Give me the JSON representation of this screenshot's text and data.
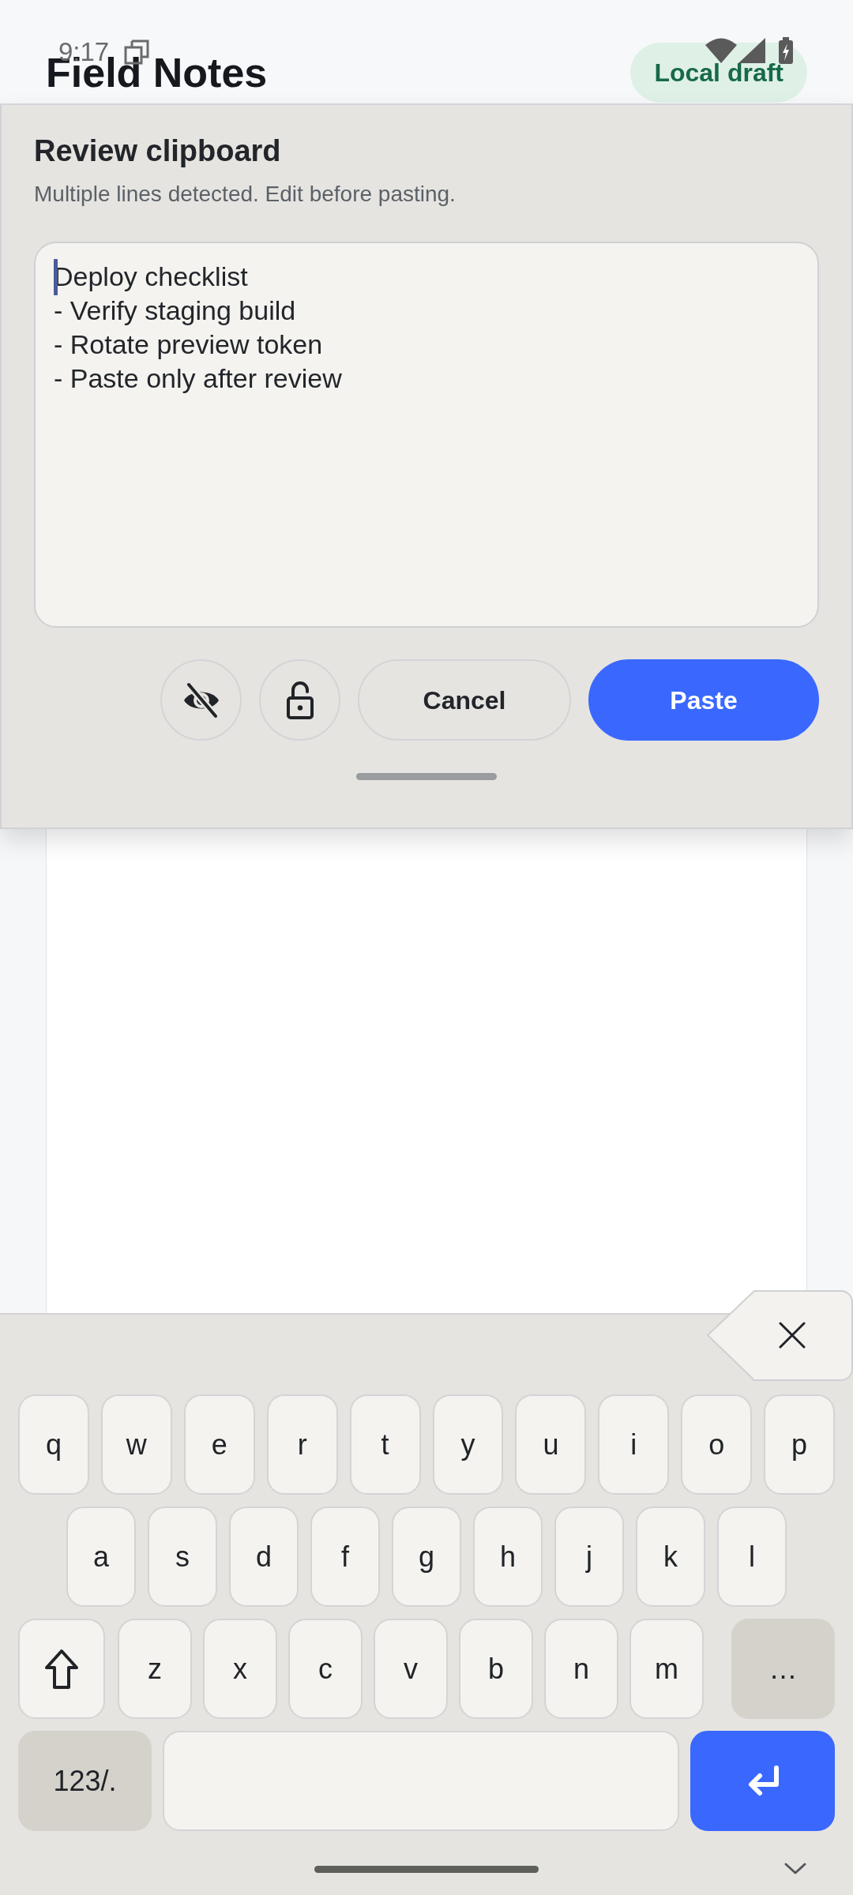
{
  "status_bar": {
    "time": "9:17"
  },
  "header": {
    "title": "Field Notes",
    "badge": "Local draft"
  },
  "dialog": {
    "title": "Review clipboard",
    "subtitle": "Multiple lines detected. Edit before pasting.",
    "editor": {
      "value": "Deploy checklist\n- Verify staging build\n- Rotate preview token\n- Paste only after review",
      "focused": true
    },
    "buttons": [
      {
        "kind": "secondary",
        "label": "Cancel"
      },
      {
        "kind": "primary",
        "label": "Paste"
      }
    ]
  },
  "keyboard": {
    "rows": [
      [
        {
          "kind": "letter",
          "label": "q"
        },
        {
          "kind": "letter",
          "label": "w"
        },
        {
          "kind": "letter",
          "label": "e"
        },
        {
          "kind": "letter",
          "label": "r"
        },
        {
          "kind": "letter",
          "label": "t"
        },
        {
          "kind": "letter",
          "label": "y"
        },
        {
          "kind": "letter",
          "label": "u"
        },
        {
          "kind": "letter",
          "label": "i"
        },
        {
          "kind": "letter",
          "label": "o"
        },
        {
          "kind": "letter",
          "label": "p"
        }
      ],
      [
        {
          "kind": "letter",
          "label": "a"
        },
        {
          "kind": "letter",
          "label": "s"
        },
        {
          "kind": "letter",
          "label": "d"
        },
        {
          "kind": "letter",
          "label": "f"
        },
        {
          "kind": "letter",
          "label": "g"
        },
        {
          "kind": "letter",
          "label": "h"
        },
        {
          "kind": "letter",
          "label": "j"
        },
        {
          "kind": "letter",
          "label": "k"
        },
        {
          "kind": "letter",
          "label": "l"
        }
      ],
      [
        {
          "kind": "shift"
        },
        {
          "kind": "letter",
          "label": "z"
        },
        {
          "kind": "letter",
          "label": "x"
        },
        {
          "kind": "letter",
          "label": "c"
        },
        {
          "kind": "letter",
          "label": "v"
        },
        {
          "kind": "letter",
          "label": "b"
        },
        {
          "kind": "letter",
          "label": "n"
        },
        {
          "kind": "letter",
          "label": "m"
        },
        {
          "kind": "function",
          "label": "…"
        }
      ],
      [
        {
          "kind": "function",
          "label": "123/."
        },
        {
          "kind": "space"
        },
        {
          "kind": "enter"
        }
      ]
    ]
  }
}
